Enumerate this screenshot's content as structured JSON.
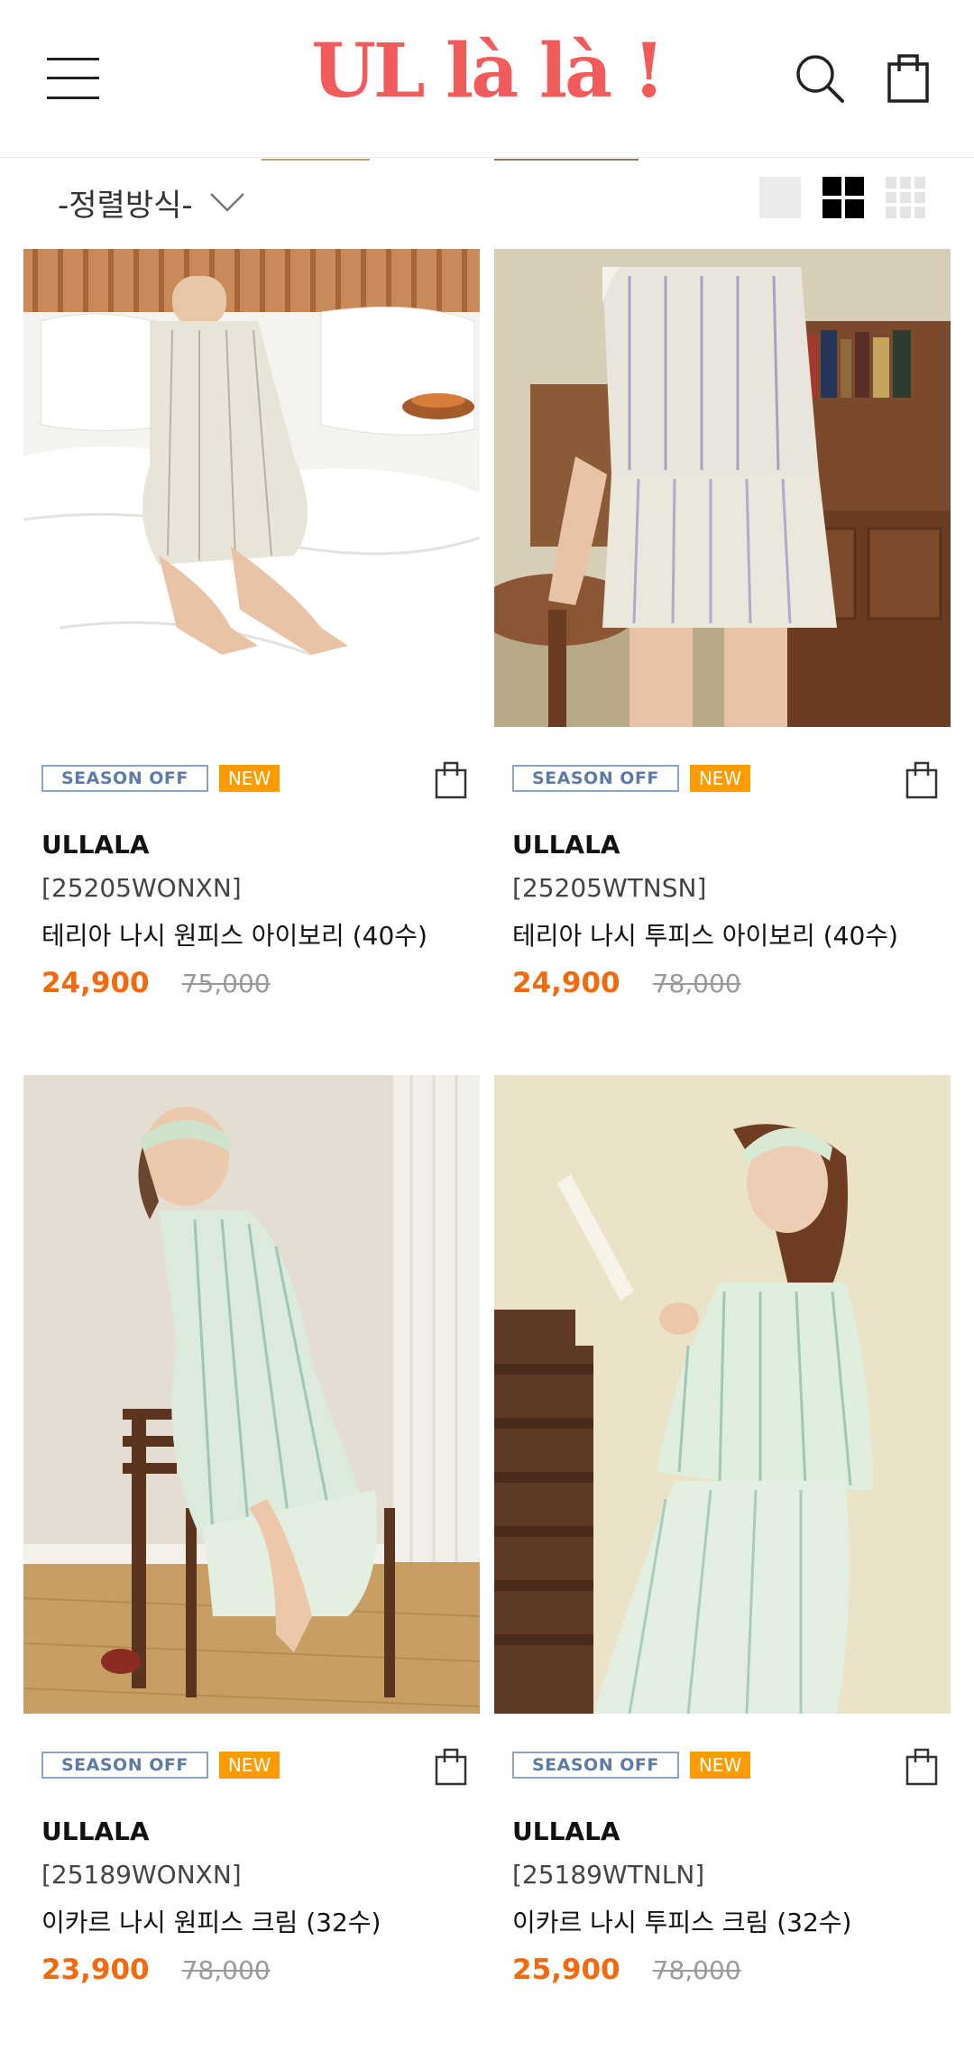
{
  "header": {
    "logo_text": "UL là là !",
    "menu_icon": "hamburger-menu-icon",
    "search_icon": "search-icon",
    "cart_icon": "shopping-bag-icon"
  },
  "toolbar": {
    "sort_label": "-정렬방식-",
    "sort_icon": "chevron-down-icon",
    "view_options": [
      "single-column-view-icon",
      "two-column-view-icon",
      "three-column-view-icon"
    ],
    "active_view": "two-column-view-icon"
  },
  "colors": {
    "brand": "#f25b5b",
    "sale_price": "#f26a0f",
    "badge_new": "#ff9b00",
    "badge_season_border": "#8aa2c4"
  },
  "products": [
    {
      "badge_season": "SEASON OFF",
      "badge_new": "NEW",
      "brand": "ULLALA",
      "code": "[25205WONXN]",
      "name": "테리아 나시 원피스 아이보리 (40수)",
      "sale_price": "24,900",
      "original_price": "75,000"
    },
    {
      "badge_season": "SEASON OFF",
      "badge_new": "NEW",
      "brand": "ULLALA",
      "code": "[25205WTNSN]",
      "name": "테리아 나시 투피스 아이보리 (40수)",
      "sale_price": "24,900",
      "original_price": "78,000"
    },
    {
      "badge_season": "SEASON OFF",
      "badge_new": "NEW",
      "brand": "ULLALA",
      "code": "[25189WONXN]",
      "name": "이카르 나시 원피스 크림 (32수)",
      "sale_price": "23,900",
      "original_price": "78,000"
    },
    {
      "badge_season": "SEASON OFF",
      "badge_new": "NEW",
      "brand": "ULLALA",
      "code": "[25189WTNLN]",
      "name": "이카르 나시 투피스 크림 (32수)",
      "sale_price": "25,900",
      "original_price": "78,000"
    }
  ]
}
